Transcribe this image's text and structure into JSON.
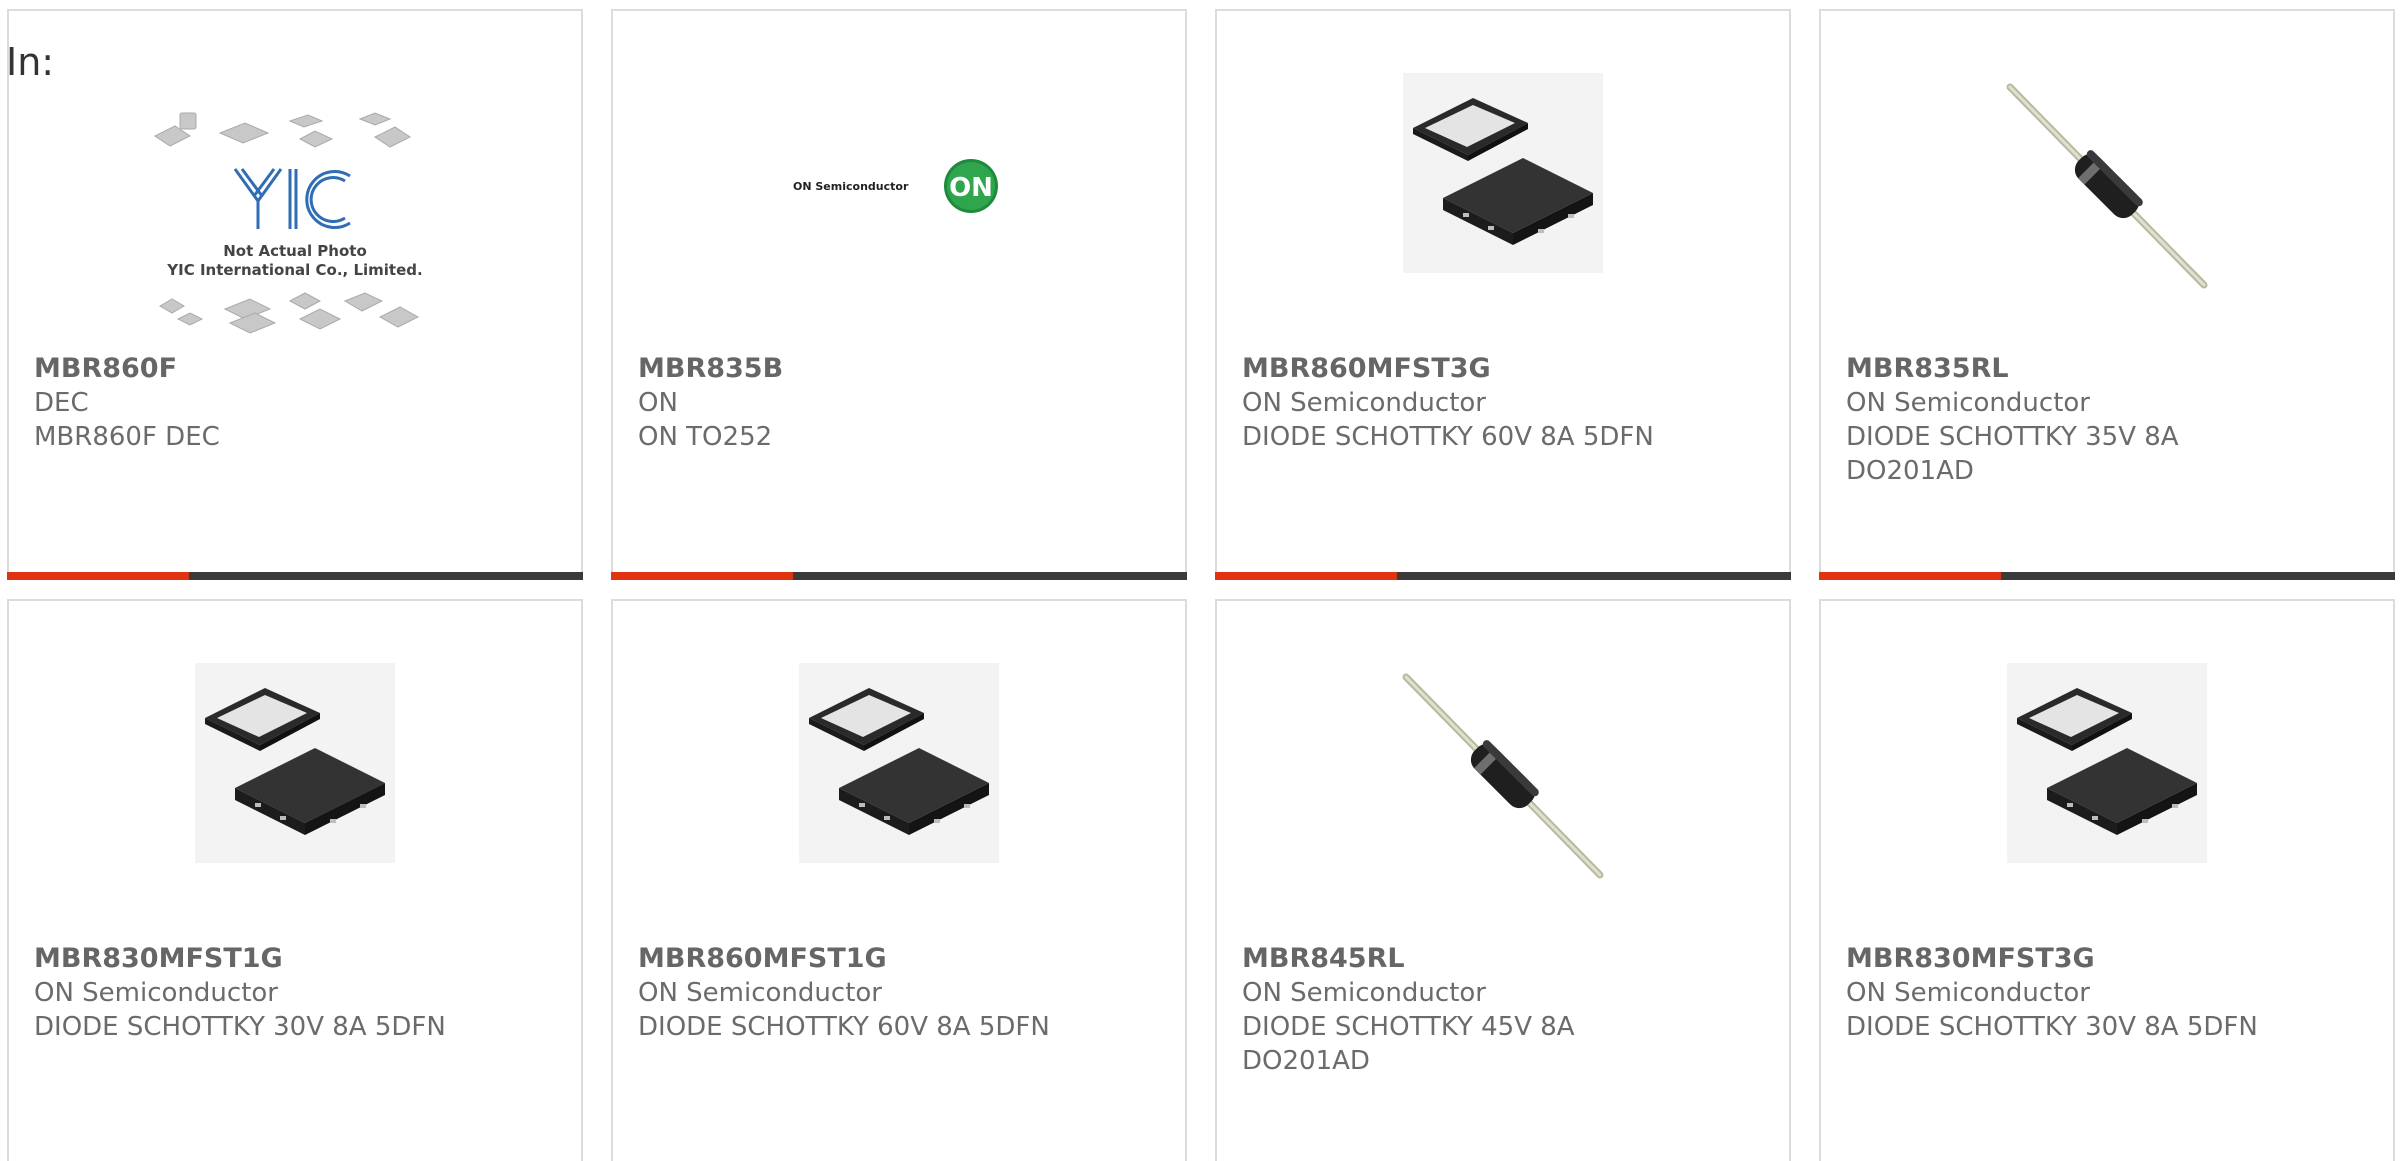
{
  "page": {
    "in_label": "In:"
  },
  "colors": {
    "accent": "#e0330f",
    "bar": "#3a3a3a",
    "border": "#dcdcdc",
    "text": "#6b6b6b"
  },
  "products": [
    {
      "part_number": "MBR860F",
      "manufacturer": "DEC",
      "description": "MBR860F DEC",
      "image": "yic-placeholder-photo",
      "image_text_line1": "Not Actual Photo",
      "image_text_line2": "YIC International Co., Limited.",
      "logo_text": "YIC"
    },
    {
      "part_number": "MBR835B",
      "manufacturer": "ON",
      "description": "ON TO252",
      "image": "on-semiconductor-logo",
      "logo_word": "ON Semiconductor",
      "logo_badge": "ON"
    },
    {
      "part_number": "MBR860MFST3G",
      "manufacturer": "ON Semiconductor",
      "description": "DIODE SCHOTTKY 60V 8A 5DFN",
      "image": "dfn-package-photo"
    },
    {
      "part_number": "MBR835RL",
      "manufacturer": "ON Semiconductor",
      "description": "DIODE SCHOTTKY 35V 8A DO201AD",
      "image": "axial-diode-photo"
    },
    {
      "part_number": "MBR830MFST1G",
      "manufacturer": "ON Semiconductor",
      "description": "DIODE SCHOTTKY 30V 8A 5DFN",
      "image": "dfn-package-photo"
    },
    {
      "part_number": "MBR860MFST1G",
      "manufacturer": "ON Semiconductor",
      "description": "DIODE SCHOTTKY 60V 8A 5DFN",
      "image": "dfn-package-photo"
    },
    {
      "part_number": "MBR845RL",
      "manufacturer": "ON Semiconductor",
      "description": "DIODE SCHOTTKY 45V 8A DO201AD",
      "image": "axial-diode-photo"
    },
    {
      "part_number": "MBR830MFST3G",
      "manufacturer": "ON Semiconductor",
      "description": "DIODE SCHOTTKY 30V 8A 5DFN",
      "image": "dfn-package-photo"
    }
  ]
}
